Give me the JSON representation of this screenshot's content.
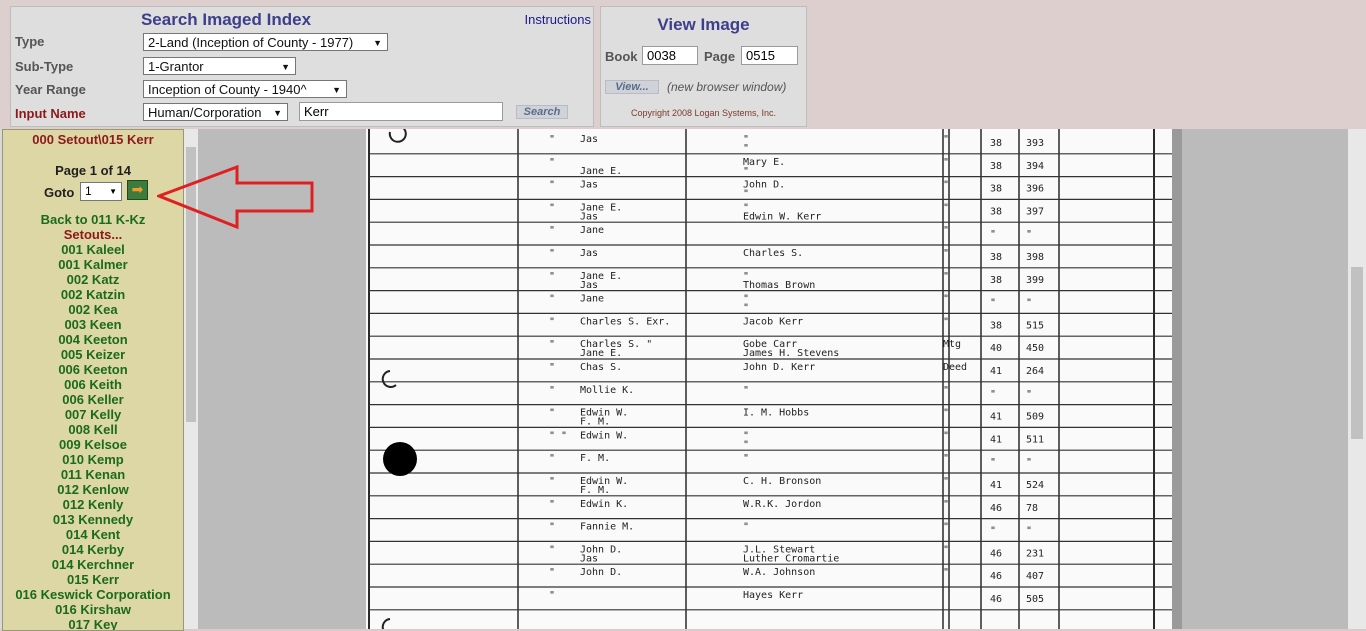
{
  "search": {
    "title": "Search Imaged Index",
    "instructions": "Instructions",
    "type_label": "Type",
    "type_value": "2-Land (Inception of County - 1977)",
    "subtype_label": "Sub-Type",
    "subtype_value": "1-Grantor",
    "year_label": "Year Range",
    "year_value": "Inception of County - 1940^",
    "name_label": "Input Name",
    "name_type_value": "Human/Corporation",
    "name_value": "Kerr",
    "search_button": "Search"
  },
  "view": {
    "title": "View Image",
    "book_label": "Book",
    "book_value": "0038",
    "page_label": "Page",
    "page_value": "0515",
    "view_button": "View...",
    "note": "(new browser window)",
    "copyright": "Copyright 2008 Logan Systems, Inc."
  },
  "nav": {
    "title": "000 Setout\\015 Kerr",
    "page_count": "Page 1 of 14",
    "goto_label": "Goto",
    "goto_value": "1",
    "back_link": "Back to 011 K-Kz",
    "setouts_label": "Setouts...",
    "items": [
      "001 Kaleel",
      "001 Kalmer",
      "002 Katz",
      "002 Katzin",
      "002 Kea",
      "003 Keen",
      "004 Keeton",
      "005 Keizer",
      "006 Keeton",
      "006 Keith",
      "006 Keller",
      "007 Kelly",
      "008 Kell",
      "009 Kelsoe",
      "010 Kemp",
      "011 Kenan",
      "012 Kenlow",
      "012 Kenly",
      "013 Kennedy",
      "014 Kent",
      "014 Kerby",
      "014 Kerchner",
      "015 Kerr",
      "016 Keswick Corporation",
      "016 Kirshaw",
      "017 Key"
    ]
  },
  "document": {
    "rows": [
      {
        "ditto": "\"",
        "name1": "Jas",
        "name2": "",
        "g1": "\"",
        "g2": "\"",
        "type": "\"",
        "book": "38",
        "page": "393"
      },
      {
        "ditto": "\"",
        "name1": "",
        "name2": "Jane E.",
        "g1": "Mary E.",
        "g2": "\"",
        "type": "\"",
        "book": "38",
        "page": "394"
      },
      {
        "ditto": "\"",
        "name1": "Jas",
        "name2": "",
        "g1": "John D.",
        "g2": "\"",
        "type": "\"",
        "book": "38",
        "page": "396"
      },
      {
        "ditto": "\"",
        "name1": "Jane E.",
        "name2": "Jas",
        "g1": "\"",
        "g2": "Edwin W. Kerr",
        "type": "\"",
        "book": "38",
        "page": "397"
      },
      {
        "ditto": "\"",
        "name1": "Jane",
        "name2": "",
        "g1": "",
        "g2": "",
        "type": "\"",
        "book": "\"",
        "page": "\""
      },
      {
        "ditto": "\"",
        "name1": "Jas",
        "name2": "",
        "g1": "Charles S.",
        "g2": "",
        "type": "\"",
        "book": "38",
        "page": "398"
      },
      {
        "ditto": "\"",
        "name1": "Jane E.",
        "name2": "Jas",
        "g1": "\"",
        "g2": "Thomas Brown",
        "type": "\"",
        "book": "38",
        "page": "399"
      },
      {
        "ditto": "\"",
        "name1": "Jane",
        "name2": "",
        "g1": "\"",
        "g2": "\"",
        "type": "\"",
        "book": "\"",
        "page": "\""
      },
      {
        "ditto": "\"",
        "name1": "Charles S. Exr.",
        "name2": "",
        "g1": "Jacob Kerr",
        "g2": "",
        "type": "\"",
        "book": "38",
        "page": "515"
      },
      {
        "ditto": "\"",
        "name1": "Charles S. \"",
        "name2": "Jane E.",
        "g1": "Gobe Carr",
        "g2": "James H. Stevens",
        "type": "Mtg",
        "book": "40",
        "page": "450"
      },
      {
        "ditto": "\"",
        "name1": "Chas S.",
        "name2": "",
        "g1": "John D. Kerr",
        "g2": "",
        "type": "Deed",
        "book": "41",
        "page": "264"
      },
      {
        "ditto": "\"",
        "name1": "Mollie K.",
        "name2": "",
        "g1": "\"",
        "g2": "",
        "type": "\"",
        "book": "\"",
        "page": "\""
      },
      {
        "ditto": "\"",
        "name1": "Edwin W.",
        "name2": "F. M.",
        "g1": "I. M. Hobbs",
        "g2": "",
        "type": "\"",
        "book": "41",
        "page": "509"
      },
      {
        "ditto": "\" \"",
        "name1": "Edwin W.",
        "name2": "",
        "g1": "\"",
        "g2": "\"",
        "type": "\"",
        "book": "41",
        "page": "511"
      },
      {
        "ditto": "\"",
        "name1": "F. M.",
        "name2": "",
        "g1": "\"",
        "g2": "",
        "type": "\"",
        "book": "\"",
        "page": "\""
      },
      {
        "ditto": "\"",
        "name1": "Edwin W.",
        "name2": "F. M.",
        "g1": "C. H. Bronson",
        "g2": "",
        "type": "\"",
        "book": "41",
        "page": "524"
      },
      {
        "ditto": "\"",
        "name1": "Edwin K.",
        "name2": "",
        "g1": "W.R.K. Jordon",
        "g2": "",
        "type": "\"",
        "book": "46",
        "page": "78"
      },
      {
        "ditto": "\"",
        "name1": "Fannie M.",
        "name2": "",
        "g1": "\"",
        "g2": "",
        "type": "\"",
        "book": "\"",
        "page": "\""
      },
      {
        "ditto": "\"",
        "name1": "John D.",
        "name2": "Jas",
        "g1": "J.L. Stewart",
        "g2": "Luther Cromartie",
        "type": "\"",
        "book": "46",
        "page": "231"
      },
      {
        "ditto": "\"",
        "name1": "John D.",
        "name2": "",
        "g1": "W.A. Johnson",
        "g2": "",
        "type": "\"",
        "book": "46",
        "page": "407"
      },
      {
        "ditto": "\"",
        "name1": "",
        "name2": "",
        "g1": "Hayes Kerr",
        "g2": "",
        "type": "",
        "book": "46",
        "page": "505"
      }
    ]
  },
  "annotation_color": "#e02020"
}
